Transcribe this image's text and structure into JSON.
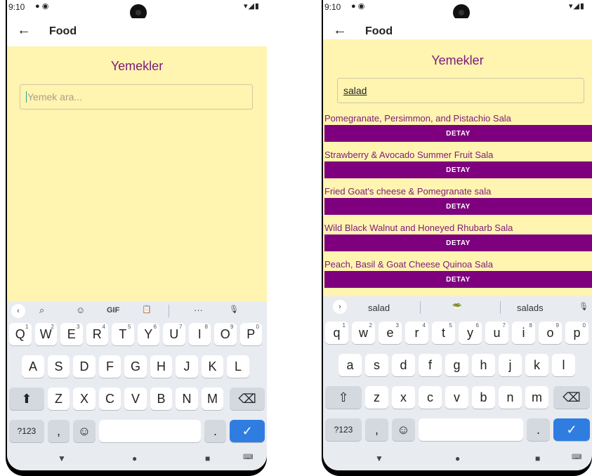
{
  "left": {
    "status": {
      "time": "9:10",
      "icons": "● ◉",
      "right": "▾◢▮"
    },
    "appbar": {
      "back_icon": "←",
      "title": "Food"
    },
    "heading": "Yemekler",
    "search": {
      "placeholder": "Yemek ara...",
      "value": ""
    },
    "keyboard": {
      "toolbar": {
        "chevron": "‹",
        "search": "⌕",
        "sticker": "☺",
        "gif": "GIF",
        "clipboard": "📋",
        "more": "···",
        "mic": "🎙"
      },
      "row1": [
        [
          "Q",
          "1"
        ],
        [
          "W",
          "2"
        ],
        [
          "E",
          "3"
        ],
        [
          "R",
          "4"
        ],
        [
          "T",
          "5"
        ],
        [
          "Y",
          "6"
        ],
        [
          "U",
          "7"
        ],
        [
          "I",
          "8"
        ],
        [
          "O",
          "9"
        ],
        [
          "P",
          "0"
        ]
      ],
      "row2": [
        "A",
        "S",
        "D",
        "F",
        "G",
        "H",
        "J",
        "K",
        "L"
      ],
      "row3": [
        "Z",
        "X",
        "C",
        "V",
        "B",
        "N",
        "M"
      ],
      "shift": "⬆",
      "backspace": "⌫",
      "sym": "?123",
      "comma": ",",
      "emoji": "☺",
      "period": ".",
      "enter": "✓"
    },
    "nav": {
      "back": "▼",
      "home": "●",
      "recent": "■",
      "kbd": "⌨"
    }
  },
  "right": {
    "status": {
      "time": "9:10",
      "icons": "● ◉",
      "right": "▾◢▮"
    },
    "appbar": {
      "back_icon": "←",
      "title": "Food"
    },
    "heading": "Yemekler",
    "search": {
      "placeholder": "Yemek ara...",
      "value": "salad"
    },
    "results": [
      {
        "name": "Pomegranate, Persimmon, and Pistachio Sala",
        "button": "DETAY"
      },
      {
        "name": "Strawberry & Avocado Summer Fruit Sala",
        "button": "DETAY"
      },
      {
        "name": "Fried Goat's cheese & Pomegranate sala",
        "button": "DETAY"
      },
      {
        "name": "Wild Black Walnut and Honeyed Rhubarb Sala",
        "button": "DETAY"
      },
      {
        "name": "Peach, Basil & Goat Cheese Quinoa Sala",
        "button": "DETAY"
      }
    ],
    "keyboard": {
      "toolbar": {
        "chevron": "›",
        "sugg1": "salad",
        "sugg2": "🥗",
        "sugg3": "salads",
        "mic": "🎙"
      },
      "row1": [
        [
          "q",
          "1"
        ],
        [
          "w",
          "2"
        ],
        [
          "e",
          "3"
        ],
        [
          "r",
          "4"
        ],
        [
          "t",
          "5"
        ],
        [
          "y",
          "6"
        ],
        [
          "u",
          "7"
        ],
        [
          "i",
          "8"
        ],
        [
          "o",
          "9"
        ],
        [
          "p",
          "0"
        ]
      ],
      "row2": [
        "a",
        "s",
        "d",
        "f",
        "g",
        "h",
        "j",
        "k",
        "l"
      ],
      "row3": [
        "z",
        "x",
        "c",
        "v",
        "b",
        "n",
        "m"
      ],
      "shift": "⇧",
      "backspace": "⌫",
      "sym": "?123",
      "comma": ",",
      "emoji": "☺",
      "period": ".",
      "enter": "✓"
    },
    "nav": {
      "back": "▼",
      "home": "●",
      "recent": "■",
      "kbd": "⌨"
    }
  },
  "colors": {
    "content_bg": "#fff4b0",
    "accent_purple": "#7e007e",
    "heading_purple": "#7b1a7b",
    "keyboard_bg": "#e8ebf0",
    "enter_blue": "#2f7de1"
  }
}
